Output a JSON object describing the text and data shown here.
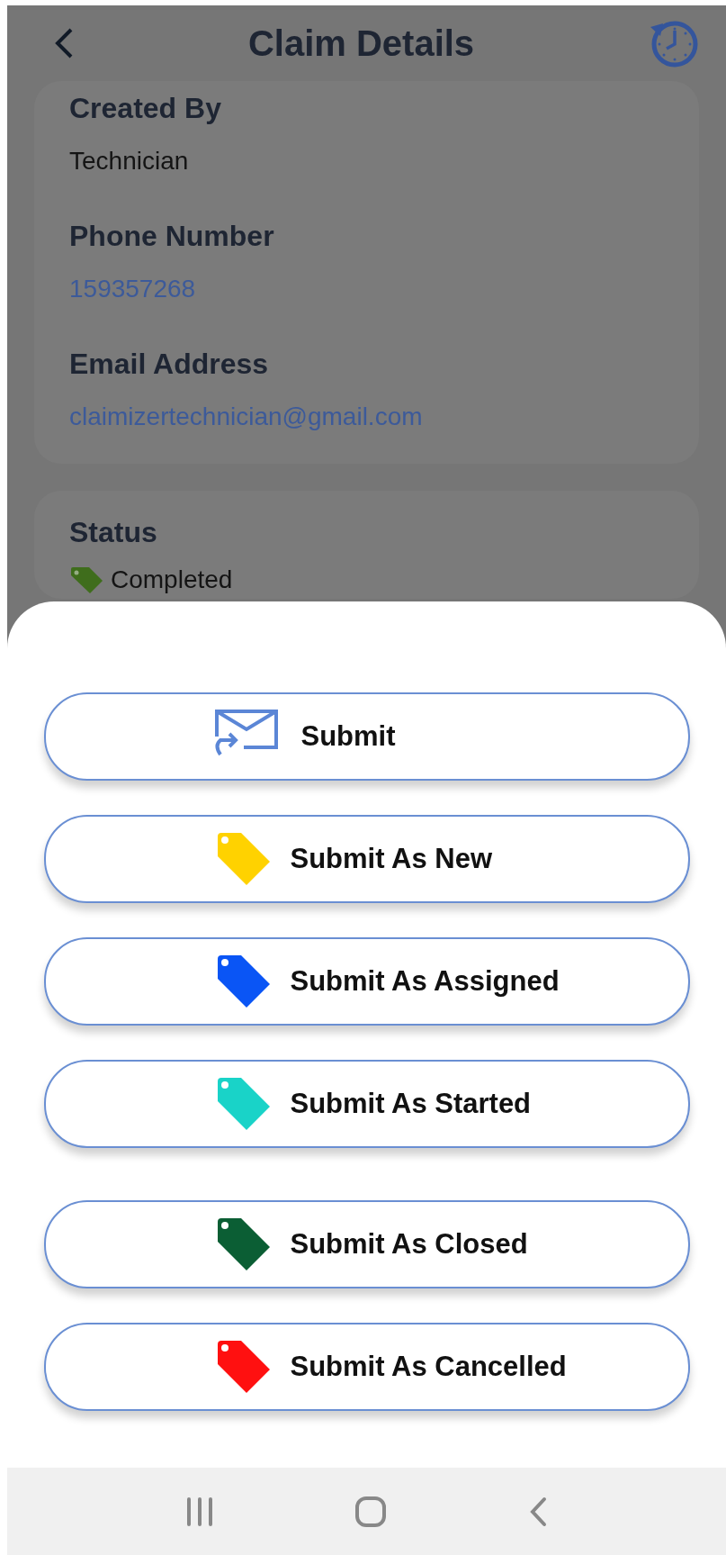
{
  "header": {
    "title": "Claim Details"
  },
  "contact_card": {
    "fields": [
      {
        "label": "Created By",
        "value": "Technician",
        "kind": "text"
      },
      {
        "label": "Phone Number",
        "value": "159357268",
        "kind": "link"
      },
      {
        "label": "Email Address",
        "value": "claimizertechnician@gmail.com",
        "kind": "link"
      }
    ]
  },
  "status_card": {
    "label": "Status",
    "value": "Completed",
    "color": "#3f6d1c"
  },
  "action_sheet": {
    "buttons": [
      {
        "label": "Submit",
        "kind": "mail"
      },
      {
        "label": "Submit As New",
        "kind": "tag",
        "color": "#ffd200"
      },
      {
        "label": "Submit As Assigned",
        "kind": "tag",
        "color": "#0a55f5"
      },
      {
        "label": "Submit As Started",
        "kind": "tag",
        "color": "#19d3c8"
      },
      {
        "label": "Submit As Closed",
        "kind": "tag",
        "color": "#0b5e34"
      },
      {
        "label": "Submit As Cancelled",
        "kind": "tag",
        "color": "#ff1010"
      }
    ]
  }
}
